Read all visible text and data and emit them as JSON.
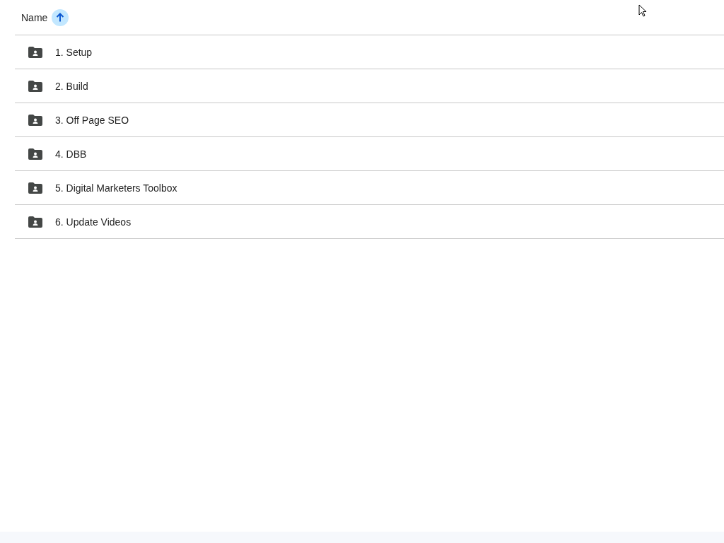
{
  "header": {
    "label": "Name",
    "ascending": true
  },
  "rows": [
    {
      "name": "1. Setup",
      "kind": "shared-folder"
    },
    {
      "name": "2. Build",
      "kind": "shared-folder"
    },
    {
      "name": "3. Off Page SEO",
      "kind": "shared-folder"
    },
    {
      "name": "4. DBB",
      "kind": "shared-folder"
    },
    {
      "name": "5. Digital Marketers Toolbox",
      "kind": "shared-folder"
    },
    {
      "name": "6. Update Videos",
      "kind": "shared-folder"
    }
  ]
}
